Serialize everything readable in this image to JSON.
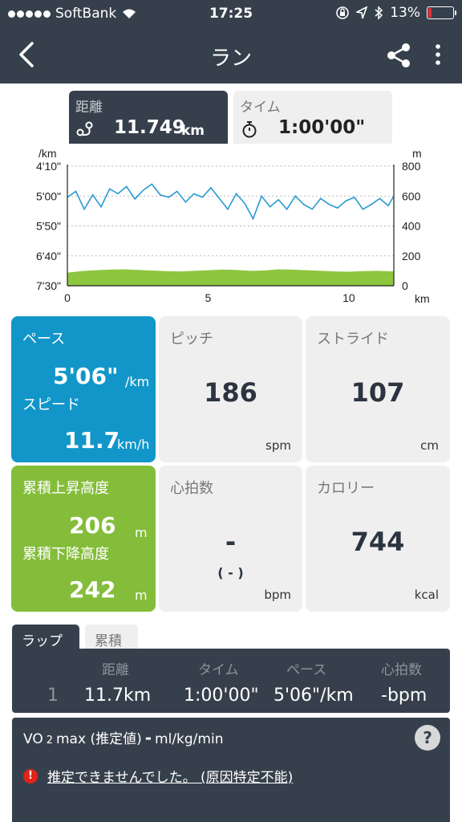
{
  "status": {
    "carrier": "SoftBank",
    "time": "17:25",
    "battery": "13%",
    "battery_level": 0.13
  },
  "nav": {
    "title": "ラン"
  },
  "summary": {
    "distance_label": "距離",
    "distance_value": "11.749",
    "distance_unit": "km",
    "time_label": "タイム",
    "time_value": "1:00'00\""
  },
  "chart_data": {
    "type": "line",
    "left_unit": "/km",
    "right_unit": "m",
    "x_unit": "km",
    "y_left_ticks": [
      "4'10\"",
      "5'00\"",
      "5'50\"",
      "6'40\"",
      "7'30\""
    ],
    "y_right_ticks": [
      "800",
      "600",
      "400",
      "200",
      "0"
    ],
    "x_ticks": [
      "0",
      "5",
      "10"
    ],
    "xlim": [
      0,
      11.749
    ],
    "ylim_right": [
      0,
      800
    ],
    "ylim_left_seconds": [
      250,
      450
    ],
    "grid": true,
    "series": [
      {
        "color": "#2a9ad0",
        "x": [
          0,
          0.3,
          0.6,
          0.9,
          1.2,
          1.5,
          1.8,
          2.1,
          2.4,
          2.7,
          3.0,
          3.3,
          3.6,
          3.9,
          4.2,
          4.5,
          4.8,
          5.1,
          5.4,
          5.7,
          6.0,
          6.3,
          6.6,
          6.9,
          7.2,
          7.5,
          7.8,
          8.1,
          8.4,
          8.7,
          9.0,
          9.3,
          9.6,
          9.9,
          10.2,
          10.5,
          10.8,
          11.1,
          11.4,
          11.7
        ],
        "y_seconds": [
          302,
          292,
          322,
          298,
          318,
          288,
          296,
          284,
          305,
          290,
          280,
          298,
          302,
          292,
          310,
          296,
          302,
          286,
          304,
          322,
          296,
          312,
          338,
          300,
          318,
          306,
          322,
          300,
          314,
          322,
          304,
          314,
          320,
          308,
          302,
          322,
          314,
          304,
          316,
          300
        ]
      },
      {
        "color": "#8dc63f",
        "x": [
          0,
          0.5,
          1.0,
          1.5,
          2.0,
          2.5,
          3.0,
          3.5,
          4.0,
          4.5,
          5.0,
          5.5,
          6.0,
          6.5,
          7.0,
          7.5,
          8.0,
          8.5,
          9.0,
          9.5,
          10.0,
          10.5,
          11.0,
          11.749
        ],
        "y_m": [
          88,
          98,
          104,
          108,
          110,
          106,
          102,
          98,
          96,
          100,
          104,
          108,
          106,
          100,
          102,
          110,
          108,
          104,
          100,
          96,
          94,
          98,
          100,
          96
        ]
      }
    ]
  },
  "tiles": {
    "pace_label": "ペース",
    "pace_value": "5'06\"",
    "pace_unit": "/km",
    "speed_label": "スピード",
    "speed_value": "11.7",
    "speed_unit": "km/h",
    "pitch_label": "ピッチ",
    "pitch_value": "186",
    "pitch_unit": "spm",
    "stride_label": "ストライド",
    "stride_value": "107",
    "stride_unit": "cm",
    "ascent_label": "累積上昇高度",
    "ascent_value": "206",
    "ascent_unit": "m",
    "descent_label": "累積下降高度",
    "descent_value": "242",
    "descent_unit": "m",
    "hr_label": "心拍数",
    "hr_value": "-",
    "hr_sub": "( - )",
    "hr_unit": "bpm",
    "cal_label": "カロリー",
    "cal_value": "744",
    "cal_unit": "kcal"
  },
  "laps": {
    "tab_lap": "ラップ",
    "tab_cumulative": "累積",
    "headers": [
      "距離",
      "タイム",
      "ペース",
      "心拍数"
    ],
    "rows": [
      {
        "index": "1",
        "distance": "11.7km",
        "time": "1:00'00\"",
        "pace": "5'06\"/km",
        "hr": "-bpm"
      }
    ]
  },
  "vo2": {
    "label_vo": "VO",
    "label_2": "2",
    "label_max": "max (推定値)",
    "value": "-",
    "unit": "ml/kg/min",
    "help": "?",
    "error_icon": "!",
    "error_text": "推定できませんでした。 (原因特定不能)"
  }
}
